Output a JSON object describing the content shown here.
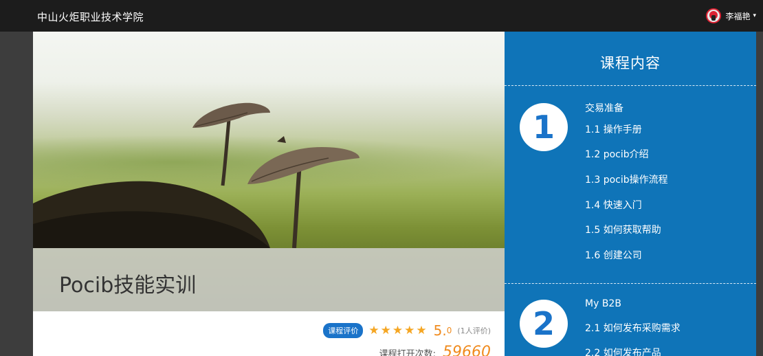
{
  "header": {
    "school_name": "中山火炬职业技术学院",
    "user_name": "李福艳",
    "caret": "▾"
  },
  "course": {
    "title": "Pocib技能实训",
    "rating_badge": "课程评价",
    "rating_stars": 5,
    "rating_big": "5.",
    "rating_small": "0",
    "rating_count": "(1人评价)",
    "opens_label": "课程打开次数:",
    "opens_value": "59660"
  },
  "panel": {
    "title": "课程内容",
    "chapters": [
      {
        "number": "1",
        "title": "交易准备",
        "lessons": [
          "1.1  操作手册",
          "1.2  pocib介绍",
          "1.3  pocib操作流程",
          "1.4  快速入门",
          "1.5  如何获取帮助",
          "1.6  创建公司"
        ]
      },
      {
        "number": "2",
        "title": "My B2B",
        "lessons": [
          "2.1  如何发布采购需求",
          "2.2  如何发布产品"
        ]
      }
    ]
  },
  "colors": {
    "panel_blue": "#0f74b8",
    "badge_blue": "#1a73c9",
    "accent_orange": "#f08b1e",
    "star_gold": "#f5a623"
  }
}
